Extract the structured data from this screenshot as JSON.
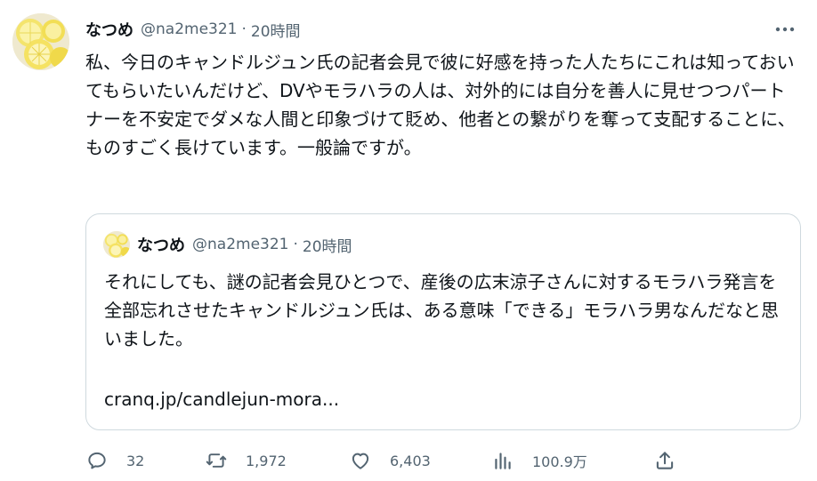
{
  "tweet": {
    "author_name": "なつめ",
    "author_handle": "@na2me321",
    "separator": "·",
    "time": "20時間",
    "text": "私、今日のキャンドルジュン氏の記者会見で彼に好感を持った人たちにこれは知っておいてもらいたいんだけど、DVやモラハラの人は、対外的には自分を善人に見せつつパートナーを不安定でダメな人間と印象づけて貶め、他者との繋がりを奪って支配することに、ものすごく長けています。一般論ですが。",
    "more_icon": "more-horizontal-icon"
  },
  "quote": {
    "author_name": "なつめ",
    "author_handle": "@na2me321",
    "separator": "·",
    "time": "20時間",
    "text": "それにしても、謎の記者会見ひとつで、産後の広末涼子さんに対するモラハラ発言を全部忘れさせたキャンドルジュン氏は、ある意味「できる」モラハラ男なんだなと思いました。",
    "link": "cranq.jp/candlejun-mora..."
  },
  "actions": {
    "reply": {
      "icon": "reply-icon",
      "count": "32"
    },
    "retweet": {
      "icon": "retweet-icon",
      "count": "1,972"
    },
    "like": {
      "icon": "heart-icon",
      "count": "6,403"
    },
    "views": {
      "icon": "views-icon",
      "count": "100.9万"
    },
    "share": {
      "icon": "share-icon"
    }
  },
  "colors": {
    "text": "#0f1419",
    "secondary": "#536471",
    "border": "#cfd9de",
    "avatar_yellow": "#f3e36a"
  }
}
